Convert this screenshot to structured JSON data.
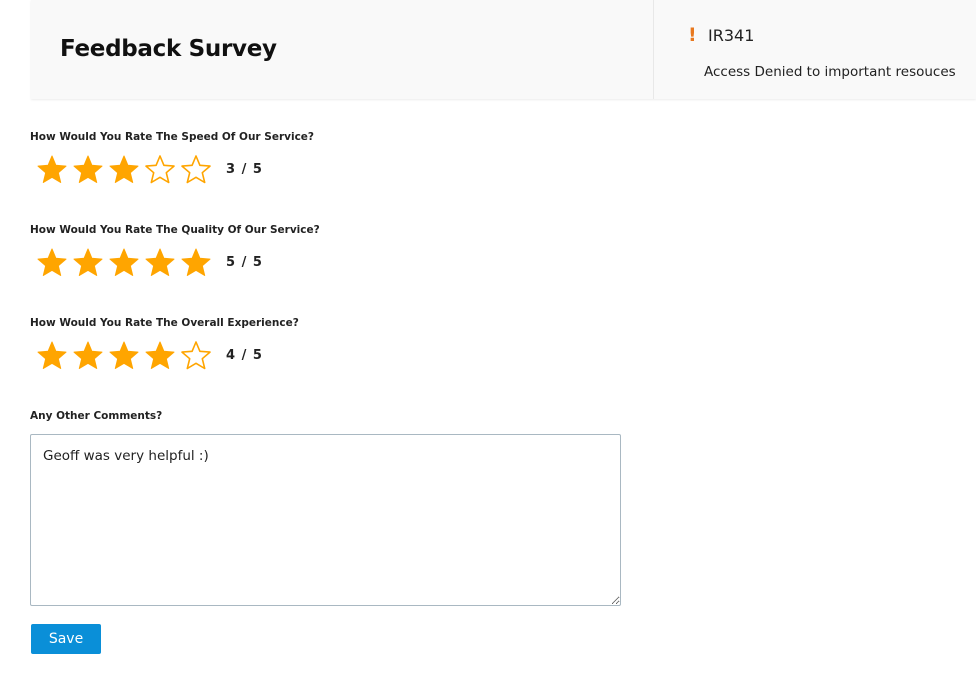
{
  "header": {
    "title": "Feedback Survey",
    "incident": {
      "icon": "alert-exclamation-icon",
      "alert_glyph": "!",
      "id": "IR341",
      "description": "Access Denied to important resouces"
    }
  },
  "colors": {
    "star_fill": "#FFA500",
    "alert": "#e8781e",
    "primary_button": "#0a8fd8"
  },
  "questions": [
    {
      "label": "How Would You Rate The Speed Of Our Service?",
      "rating": 3,
      "max": 5,
      "score_text": "3 / 5"
    },
    {
      "label": "How Would You Rate The Quality Of Our Service?",
      "rating": 5,
      "max": 5,
      "score_text": "5 / 5"
    },
    {
      "label": "How Would You Rate The Overall Experience?",
      "rating": 4,
      "max": 5,
      "score_text": "4 / 5"
    }
  ],
  "comments": {
    "label": "Any Other Comments?",
    "value": "Geoff was very helpful :)"
  },
  "actions": {
    "save_label": "Save"
  }
}
